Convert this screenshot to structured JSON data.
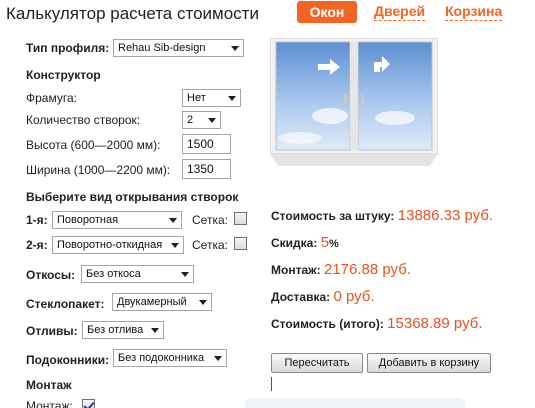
{
  "header": {
    "title": "Калькулятор расчета стоимости",
    "tabs": [
      {
        "label": "Окон",
        "active": true
      },
      {
        "label": "Дверей",
        "active": false
      },
      {
        "label": "Корзина",
        "active": false
      }
    ]
  },
  "profile": {
    "label": "Тип профиля:",
    "value": "Rehau Sib-design"
  },
  "constructor": {
    "heading": "Конструктор",
    "transom_label": "Фрамуга:",
    "transom_value": "Нет",
    "sashes_label": "Количество створок:",
    "sashes_value": "2",
    "height_label": "Высота (600—2000 мм):",
    "height_value": "1500",
    "width_label": "Ширина (1000—2200 мм):",
    "width_value": "1350"
  },
  "opening": {
    "heading": "Выберите вид открывания створок",
    "sash1_label": "1-я:",
    "sash1_value": "Поворотная",
    "sash2_label": "2-я:",
    "sash2_value": "Поворотно-откидная",
    "mesh_label": "Сетка:"
  },
  "options": {
    "slopes_label": "Откосы:",
    "slopes_value": "Без откоса",
    "glass_label": "Стеклопакет:",
    "glass_value": "Двукамерный",
    "drip_label": "Отливы:",
    "drip_value": "Без отлива",
    "sill_label": "Подоконники:",
    "sill_value": "Без подоконника",
    "mount_heading": "Монтаж",
    "mount_label": "Монтаж:"
  },
  "prices": {
    "unit_label": "Стоимость за штуку:",
    "unit_value": "13886.33 руб.",
    "discount_label": "Скидка:",
    "discount_value": "5",
    "discount_unit": "%",
    "install_label": "Монтаж:",
    "install_value": "2176.88 руб.",
    "delivery_label": "Доставка:",
    "delivery_value": "0 руб.",
    "total_label": "Стоимость (итого):",
    "total_value": "15368.89 руб."
  },
  "buttons": {
    "recalc": "Пересчитать",
    "add_to_cart": "Добавить в корзину"
  },
  "colors": {
    "accent": "#f26522",
    "price": "#e8521e"
  }
}
